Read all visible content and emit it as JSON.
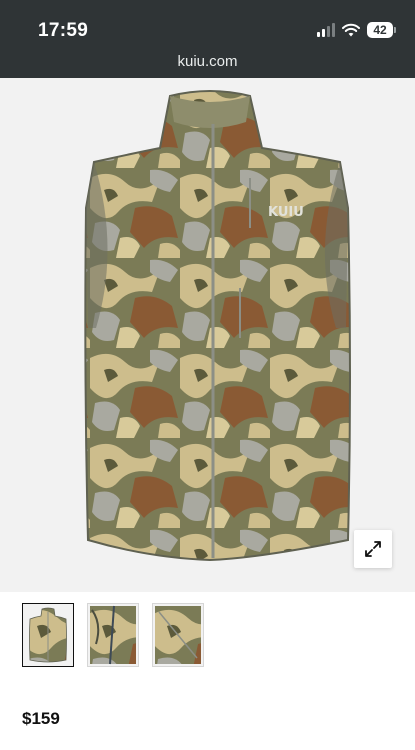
{
  "status_bar": {
    "time": "17:59",
    "battery_level": "42",
    "icons": [
      "cellular-signal-icon",
      "wifi-icon",
      "battery-icon"
    ]
  },
  "browser": {
    "url": "kuiu.com"
  },
  "product": {
    "brand_mark": "KUIU",
    "price": "$159",
    "thumbnail_count": 3,
    "selected_thumbnail": 0
  },
  "colors": {
    "status_bar_bg": "#2f3436",
    "image_bg": "#f2f2f2",
    "camo_olive": "#7b7b56",
    "camo_tan": "#cdbd8c",
    "camo_brown": "#8a5a34",
    "camo_grey": "#a9a9a0"
  }
}
